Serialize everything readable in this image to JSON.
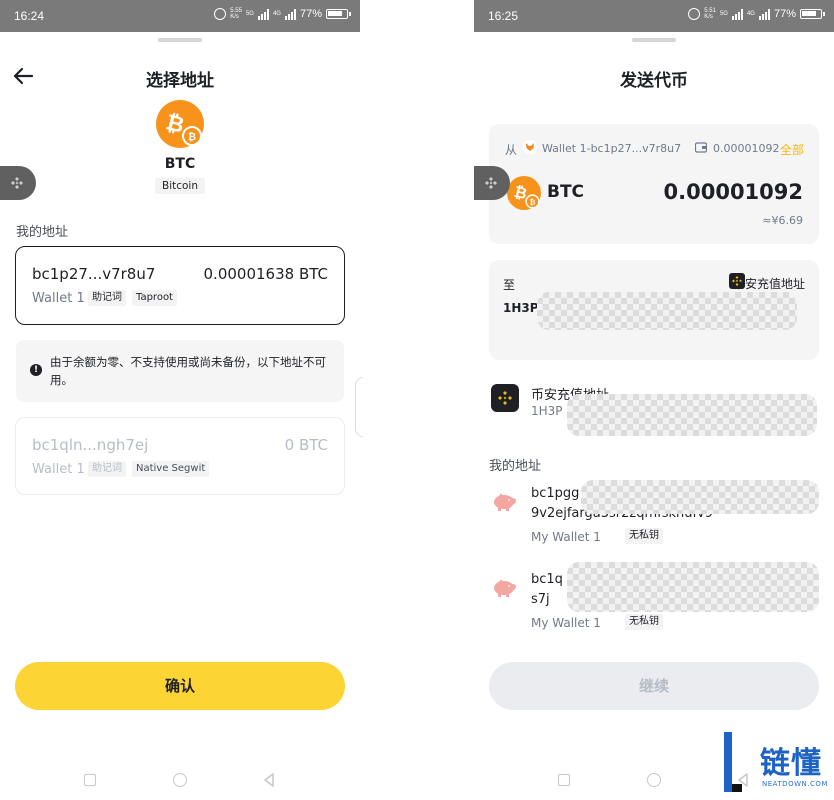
{
  "left_screen": {
    "status": {
      "time": "16:24",
      "net_speed_top": "5.55",
      "net_speed_bottom": "K/s",
      "signal_1": "5G",
      "signal_2": "4G",
      "battery": "77%"
    },
    "title": "选择地址",
    "coin": {
      "symbol": "BTC",
      "name": "Bitcoin"
    },
    "section_label": "我的地址",
    "selected_address": {
      "address": "bc1p27...v7r8u7",
      "balance": "0.00001638 BTC",
      "wallet": "Wallet 1",
      "tags": [
        "助记词",
        "Taproot"
      ]
    },
    "notice": "由于余额为零、不支持使用或尚未备份，以下地址不可用。",
    "disabled_address": {
      "address": "bc1qln...ngh7ej",
      "balance": "0 BTC",
      "wallet": "Wallet 1",
      "tags": [
        "助记词",
        "Native Segwit"
      ]
    },
    "confirm_label": "确认"
  },
  "right_screen": {
    "status": {
      "time": "16:25",
      "net_speed_top": "5.51",
      "net_speed_bottom": "K/s",
      "signal_1": "5G",
      "signal_2": "4G",
      "battery": "77%"
    },
    "title": "发送代币",
    "from": {
      "label": "从",
      "wallet": "Wallet 1-bc1p27...v7r8u7",
      "balance": "0.00001092",
      "all_label": "全部"
    },
    "send": {
      "coin": "BTC",
      "amount": "0.00001092",
      "fiat": "≈¥6.69"
    },
    "to": {
      "label": "至",
      "badge": "币安充值地址",
      "address_prefix": "1H3P"
    },
    "binance_contact": {
      "name": "币安充值地址",
      "address_prefix": "1H3P"
    },
    "section_label": "我的地址",
    "my_addresses": [
      {
        "line1": "bc1pgg",
        "line2": "9v2ejfarga3sr2zqmfskhufv9",
        "wallet": "My Wallet 1",
        "tag": "无私钥"
      },
      {
        "line1": "bc1q",
        "line2": "s7j",
        "wallet": "My Wallet 1",
        "tag": "无私钥"
      }
    ],
    "continue_label": "继续"
  },
  "watermark": {
    "text": "链懂",
    "sub": "NEATDOWN.COM"
  },
  "colors": {
    "accent_yellow": "#fcd535",
    "btc_orange": "#f7931a",
    "binance_gold": "#f0b90b",
    "text_primary": "#1e2026",
    "text_secondary": "#707a8a"
  },
  "icons": [
    "back-arrow-icon",
    "bitcoin-icon",
    "binance-icon",
    "info-icon",
    "fox-icon",
    "wallet-icon",
    "pig-icon"
  ]
}
